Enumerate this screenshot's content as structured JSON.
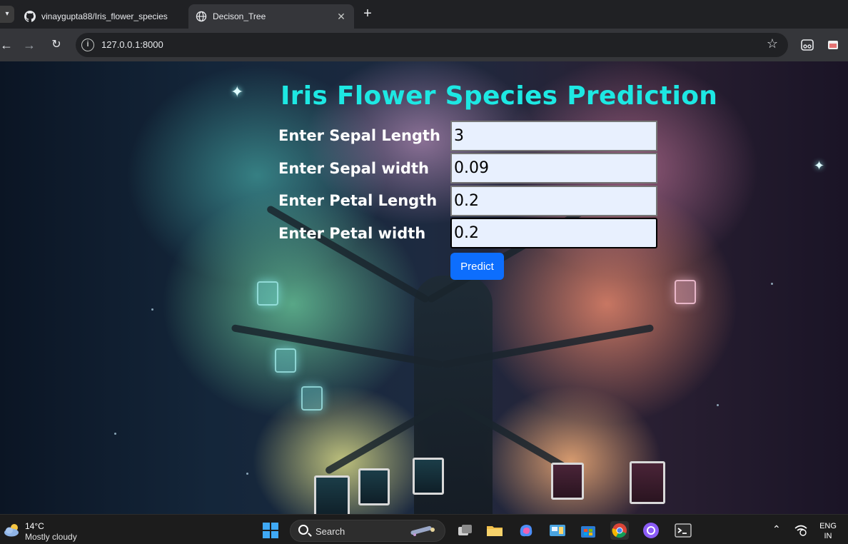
{
  "browser": {
    "tabs": [
      {
        "title": "vinaygupta88/Iris_flower_species",
        "icon": "github-icon",
        "active": false
      },
      {
        "title": "Decison_Tree",
        "icon": "globe-icon",
        "active": true
      }
    ],
    "url": "127.0.0.1:8000"
  },
  "page": {
    "title": "Iris Flower Species Prediction",
    "fields": [
      {
        "label": "Enter Sepal Length",
        "value": "3"
      },
      {
        "label": "Enter Sepal width",
        "value": "0.09"
      },
      {
        "label": "Enter Petal Length",
        "value": "0.2"
      },
      {
        "label": "Enter Petal width",
        "value": "0.2"
      }
    ],
    "submit_label": "Predict",
    "colors": {
      "title": "#1de8e3",
      "button": "#0d6efd",
      "field_bg": "#e8f0fe"
    }
  },
  "taskbar": {
    "temperature": "14°C",
    "condition": "Mostly cloudy",
    "search_label": "Search",
    "lang_line1": "ENG",
    "lang_line2": "IN"
  }
}
